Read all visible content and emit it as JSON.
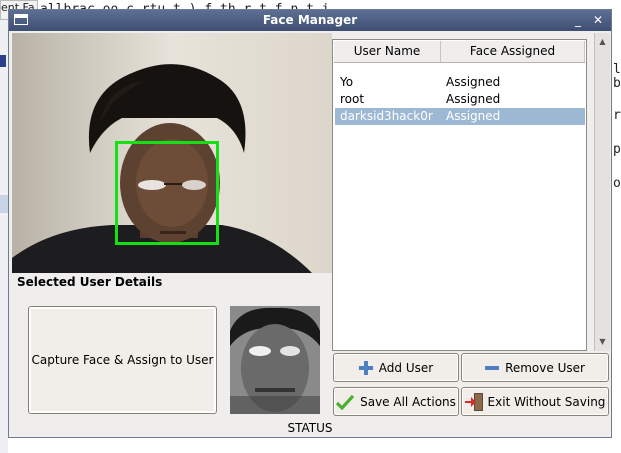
{
  "background": {
    "left_tab_label": "ent Fa",
    "code_fragment": "allbrac   oo        c       rtu       t  ) f  th        r  t  f   n    t  i       ",
    "right_chars": [
      "l",
      "b",
      "r",
      "p",
      "o"
    ]
  },
  "window": {
    "title": "Face Manager",
    "minimize_glyph": "_",
    "close_glyph": "✕"
  },
  "details": {
    "section_label": "Selected User Details",
    "capture_button_label": "Capture Face & Assign to User"
  },
  "user_table": {
    "columns": [
      "User Name",
      "Face Assigned"
    ],
    "rows": [
      {
        "name": "Yo",
        "face": "Assigned",
        "selected": false
      },
      {
        "name": "root",
        "face": "Assigned",
        "selected": false
      },
      {
        "name": "darksid3hack0r",
        "face": "Assigned",
        "selected": true
      }
    ]
  },
  "buttons": {
    "add_user": "Add User",
    "remove_user": "Remove User",
    "save_all": "Save All Actions",
    "exit_without_saving": "Exit Without Saving"
  },
  "icons": {
    "add": "plus-icon",
    "remove": "minus-icon",
    "save": "checkmark-icon",
    "exit": "exit-door-icon"
  },
  "colors": {
    "face_box": "#14e014",
    "selection": "#9db8d2",
    "titlebar": "#4a5b80"
  },
  "status": "STATUS"
}
